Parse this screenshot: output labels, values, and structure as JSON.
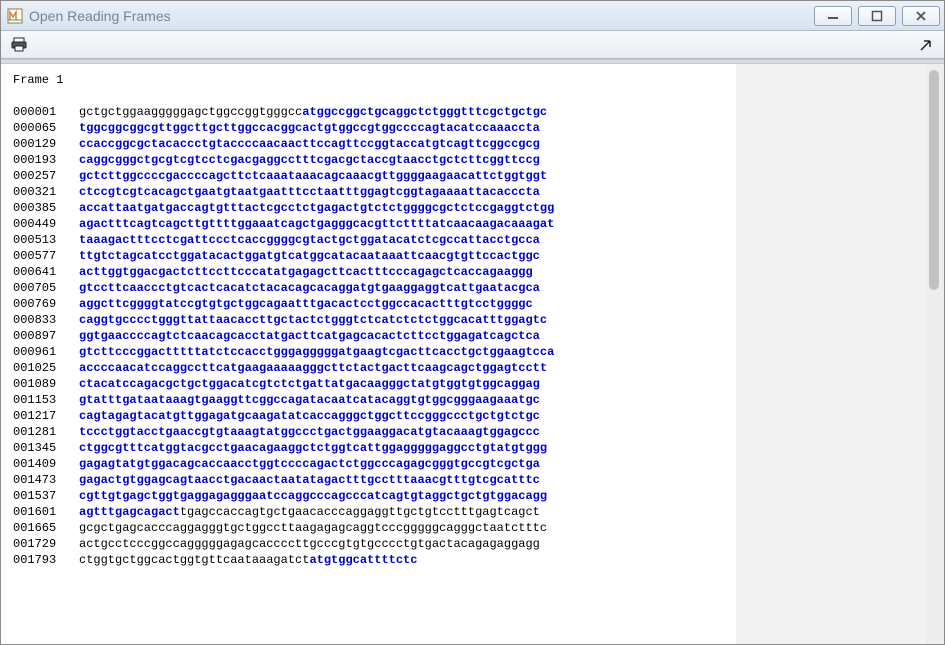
{
  "window": {
    "title": "Open Reading Frames"
  },
  "frame_header": "Frame 1",
  "lines": [
    {
      "pos": "000001",
      "spans": [
        {
          "t": "gctgctggaagggggagctggccggtgggcc",
          "c": "black"
        },
        {
          "t": "atggccggctgcaggctctgggtttcgctgctgc",
          "c": "blue"
        }
      ]
    },
    {
      "pos": "000065",
      "spans": [
        {
          "t": "tggcggcggcgttggcttgcttggccacggcactgtggccgtggccccagtacatccaaaccta",
          "c": "blue"
        }
      ]
    },
    {
      "pos": "000129",
      "spans": [
        {
          "t": "ccaccggcgctacaccctgtaccccaacaacttccagttccggtaccatgtcagttcggccgcg",
          "c": "blue"
        }
      ]
    },
    {
      "pos": "000193",
      "spans": [
        {
          "t": "caggcgggctgcgtcgtcctcgacgaggcctttcgacgctaccgtaacctgctcttcggttccg",
          "c": "blue"
        }
      ]
    },
    {
      "pos": "000257",
      "spans": [
        {
          "t": "gctcttggccccgaccccagcttctcaaataaacagcaaacgttggggaagaacattctggtggt",
          "c": "blue"
        }
      ]
    },
    {
      "pos": "000321",
      "spans": [
        {
          "t": "ctccgtcgtcacagctgaatgtaatgaatttcctaatttggagtcggtagaaaattacacccta",
          "c": "blue"
        }
      ]
    },
    {
      "pos": "000385",
      "spans": [
        {
          "t": "accattaatgatgaccagtgtttactcgcctctgagactgtctctggggcgctctccgaggtctgg",
          "c": "blue"
        }
      ]
    },
    {
      "pos": "000449",
      "spans": [
        {
          "t": "agactttcagtcagcttgttttggaaatcagctgagggcacgttcttttatcaacaagacaaagat",
          "c": "blue"
        }
      ]
    },
    {
      "pos": "000513",
      "spans": [
        {
          "t": "taaagactttcctcgattccctcaccggggcgtactgctggatacatctcgccattacctgcca",
          "c": "blue"
        }
      ]
    },
    {
      "pos": "000577",
      "spans": [
        {
          "t": "ttgtctagcatcctggatacactggatgtcatggcatacaataaattcaacgtgttccactggc",
          "c": "blue"
        }
      ]
    },
    {
      "pos": "000641",
      "spans": [
        {
          "t": "acttggtggacgactcttccttcccatatgagagcttcactttcccagagctcaccagaaggg",
          "c": "blue"
        }
      ]
    },
    {
      "pos": "000705",
      "spans": [
        {
          "t": "gtccttcaaccctgtcactcacatctacacagcacaggatgtgaaggaggtcattgaatacgca",
          "c": "blue"
        }
      ]
    },
    {
      "pos": "000769",
      "spans": [
        {
          "t": "aggcttcggggtatccgtgtgctggcagaatttgacactcctggccacactttgtcctggggc",
          "c": "blue"
        }
      ]
    },
    {
      "pos": "000833",
      "spans": [
        {
          "t": "caggtgcccctgggttattaacaccttgctactctgggtctcatctctctggcacatttggagtc",
          "c": "blue"
        }
      ]
    },
    {
      "pos": "000897",
      "spans": [
        {
          "t": "ggtgaaccccagtctcaacagcacctatgacttcatgagcacactcttcctggagatcagctca",
          "c": "blue"
        }
      ]
    },
    {
      "pos": "000961",
      "spans": [
        {
          "t": "gtcttcccggactttttatctccacctgggagggggatgaagtcgacttcacctgctggaagtcca",
          "c": "blue"
        }
      ]
    },
    {
      "pos": "001025",
      "spans": [
        {
          "t": "accccaacatccaggccttcatgaagaaaaagggcttctactgacttcaagcagctggagtcctt",
          "c": "blue"
        }
      ]
    },
    {
      "pos": "001089",
      "spans": [
        {
          "t": "ctacatccagacgctgctggacatcgtctctgattatgacaagggctatgtggtgtggcaggag",
          "c": "blue"
        }
      ]
    },
    {
      "pos": "001153",
      "spans": [
        {
          "t": "gtatttgataataaagtgaaggttcggccagatacaatcatacaggtgtggcgggaagaaatgc",
          "c": "blue"
        }
      ]
    },
    {
      "pos": "001217",
      "spans": [
        {
          "t": "cagtagagtacatgttggagatgcaagatatcaccagggctggcttccgggccctgctgtctgc",
          "c": "blue"
        }
      ]
    },
    {
      "pos": "001281",
      "spans": [
        {
          "t": "tccctggtacctgaaccgtgtaaagtatggccctgactggaaggacatgtacaaagtggagccc",
          "c": "blue"
        }
      ]
    },
    {
      "pos": "001345",
      "spans": [
        {
          "t": "ctggcgtttcatggtacgcctgaacagaaggctctggtcattggagggggaggcctgtatgtggg",
          "c": "blue"
        }
      ]
    },
    {
      "pos": "001409",
      "spans": [
        {
          "t": "gagagtatgtggacagcaccaacctggtccccagactctggcccagagcgggtgccgtcgctga",
          "c": "blue"
        }
      ]
    },
    {
      "pos": "001473",
      "spans": [
        {
          "t": "gagactgtggagcagtaacctgacaactaatatagactttgcctttaaacgtttgtcgcatttc",
          "c": "blue"
        }
      ]
    },
    {
      "pos": "001537",
      "spans": [
        {
          "t": "cgttgtgagctggtgaggagagggaatccaggcccagcccatcagtgtaggctgctgtggacagg",
          "c": "blue"
        }
      ]
    },
    {
      "pos": "001601",
      "spans": [
        {
          "t": "agtttgagcagact",
          "c": "blue"
        },
        {
          "t": "tgagccaccagtgctgaacacccaggaggttgctgtcctttgagtcagct",
          "c": "black"
        }
      ]
    },
    {
      "pos": "001665",
      "spans": [
        {
          "t": "gcgctgagcacccaggagggtgctggccttaagagagcaggtcccgggggcagggctaatctttc",
          "c": "black"
        }
      ]
    },
    {
      "pos": "001729",
      "spans": [
        {
          "t": "actgcctcccggccagggggagagcaccccttgcccgtgtgcccctgtgactacagagaggagg",
          "c": "black"
        }
      ]
    },
    {
      "pos": "001793",
      "spans": [
        {
          "t": "ctggtgctggcactggtgttcaataaagatct",
          "c": "black"
        },
        {
          "t": "atgtggcattttctc",
          "c": "blue"
        }
      ]
    }
  ]
}
